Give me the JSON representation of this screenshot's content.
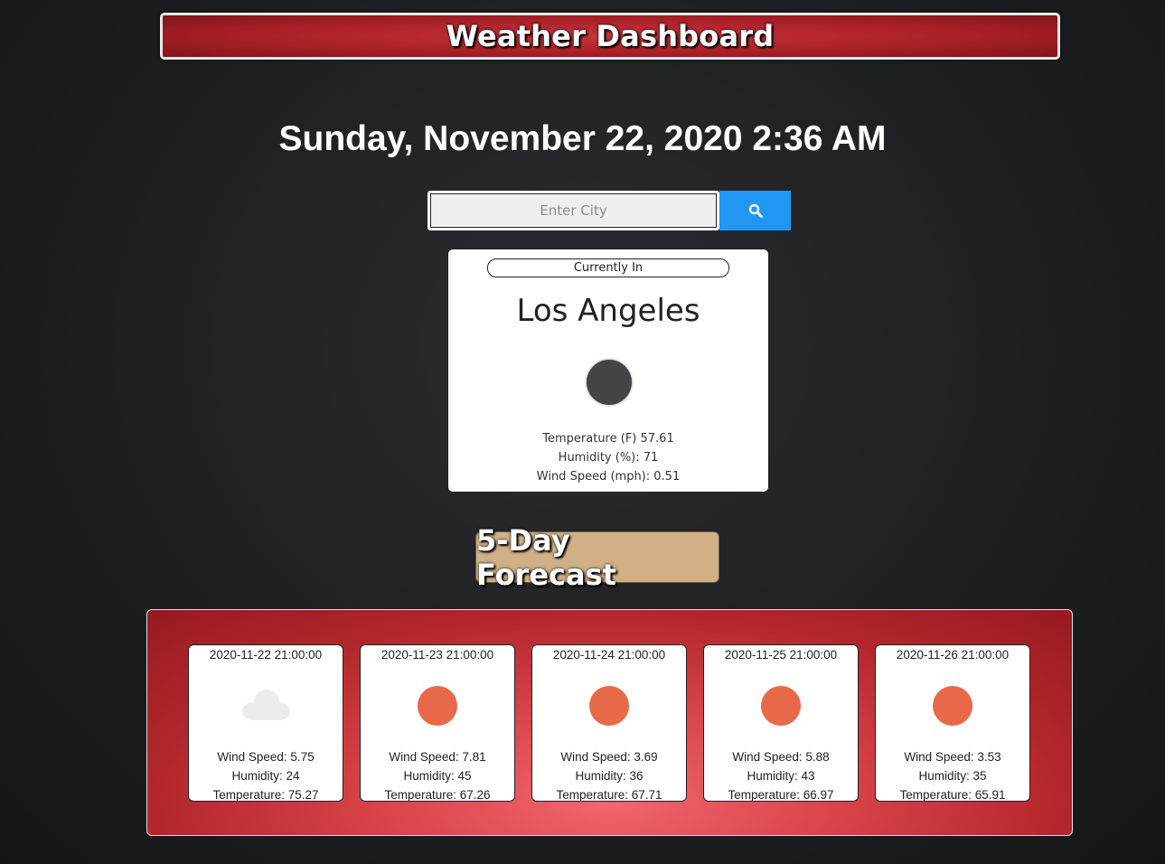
{
  "header": {
    "title": "Weather Dashboard"
  },
  "datetime": "Sunday, November 22, 2020 2:36 AM",
  "search": {
    "placeholder": "Enter City",
    "value": "",
    "button_icon": "search-icon"
  },
  "current": {
    "label": "Currently In",
    "city": "Los Angeles",
    "icon": "night-clear-icon",
    "temperature": "Temperature (F) 57.61",
    "humidity": "Humidity (%): 71",
    "wind_speed": "Wind Speed (mph): 0.51"
  },
  "forecast": {
    "heading": "5-Day Forecast",
    "days": [
      {
        "date": "2020-11-22 21:00:00",
        "icon": "cloud-icon",
        "wind": "Wind Speed: 5.75",
        "humidity": "Humidity: 24",
        "temperature": "Temperature: 75.27"
      },
      {
        "date": "2020-11-23 21:00:00",
        "icon": "sun-icon",
        "wind": "Wind Speed: 7.81",
        "humidity": "Humidity: 45",
        "temperature": "Temperature: 67.26"
      },
      {
        "date": "2020-11-24 21:00:00",
        "icon": "sun-icon",
        "wind": "Wind Speed: 3.69",
        "humidity": "Humidity: 36",
        "temperature": "Temperature: 67.71"
      },
      {
        "date": "2020-11-25 21:00:00",
        "icon": "sun-icon",
        "wind": "Wind Speed: 5.88",
        "humidity": "Humidity: 43",
        "temperature": "Temperature: 66.97"
      },
      {
        "date": "2020-11-26 21:00:00",
        "icon": "sun-icon",
        "wind": "Wind Speed: 3.53",
        "humidity": "Humidity: 35",
        "temperature": "Temperature: 65.91"
      }
    ]
  },
  "colors": {
    "header_red": "#a51f25",
    "search_button": "#2196f3",
    "forecast_heading_bg": "#d1b088",
    "sun": "#e8694a",
    "moon": "#444446",
    "cloud": "#ececec"
  }
}
